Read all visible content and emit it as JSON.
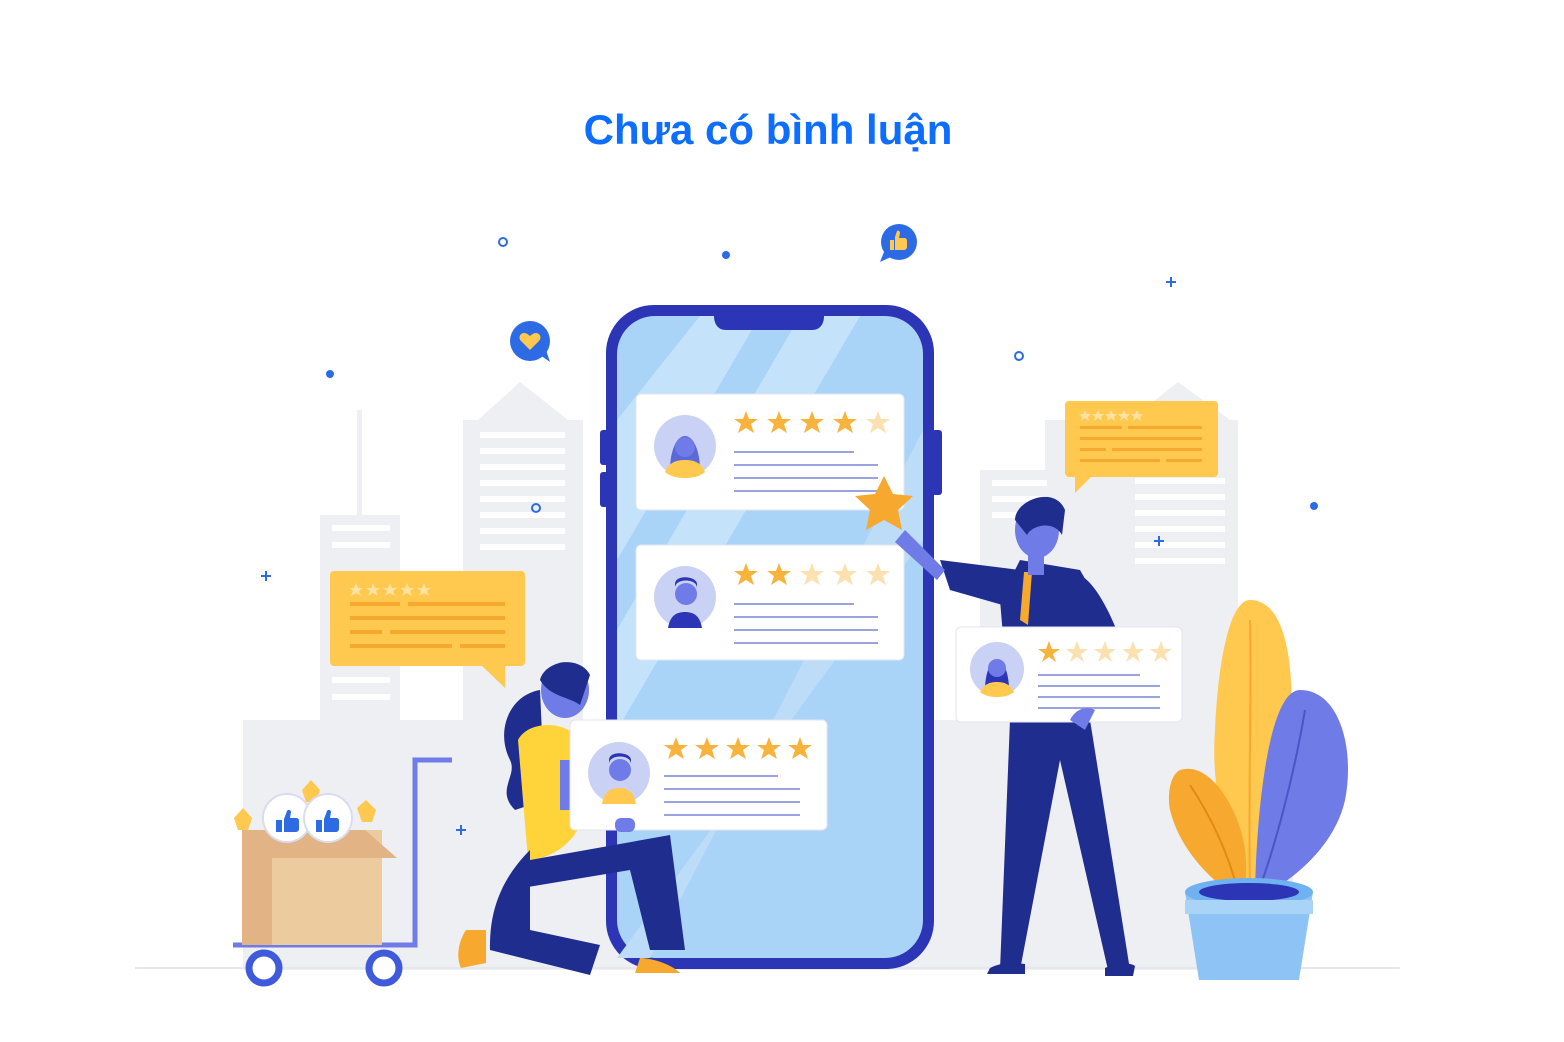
{
  "empty_state": {
    "title": "Chưa có bình luận",
    "title_color": "#0d6efd"
  },
  "illustration": {
    "description_icons": [
      "like-bubble-icon",
      "heart-bubble-icon",
      "star-icon",
      "shopping-cart-icon",
      "plant-icon",
      "smartphone-icon"
    ],
    "review_cards": [
      {
        "avatar": "woman-avatar-icon",
        "rating": 4,
        "max": 5
      },
      {
        "avatar": "man-avatar-icon",
        "rating": 2,
        "max": 5
      },
      {
        "avatar": "man-avatar-icon",
        "rating": 5,
        "max": 5
      },
      {
        "avatar": "woman-avatar-icon",
        "rating": 1,
        "max": 5
      }
    ],
    "colors": {
      "accent": "#0d6efd",
      "star": "#f7b33c",
      "navy": "#1f2d8f",
      "bubble": "#ffc950",
      "phone_screen": "#a9d4f7"
    }
  }
}
